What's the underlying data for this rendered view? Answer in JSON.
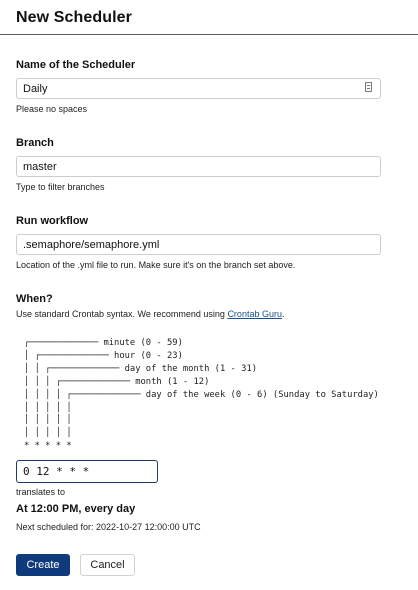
{
  "page": {
    "title": "New Scheduler"
  },
  "name_field": {
    "label": "Name of the Scheduler",
    "value": "Daily",
    "hint": "Please no spaces"
  },
  "branch_field": {
    "label": "Branch",
    "value": "master",
    "hint": "Type to filter branches"
  },
  "workflow_field": {
    "label": "Run workflow",
    "value": ".semaphore/semaphore.yml",
    "hint": "Location of the .yml file to run. Make sure it's on the branch set above."
  },
  "when": {
    "label": "When?",
    "hint_prefix": "Use standard Crontab syntax. We recommend using ",
    "hint_link": "Crontab Guru",
    "hint_suffix": ".",
    "diagram": "┌───────────── minute (0 - 59)\n│ ┌───────────── hour (0 - 23)\n│ │ ┌───────────── day of the month (1 - 31)\n│ │ │ ┌───────────── month (1 - 12)\n│ │ │ │ ┌───────────── day of the week (0 - 6) (Sunday to Saturday)\n│ │ │ │ │\n│ │ │ │ │\n│ │ │ │ │\n* * * * *",
    "cron_value": "0 12 * * *",
    "translates_label": "translates to",
    "result": "At 12:00 PM, every day",
    "next_scheduled": "Next scheduled for: 2022-10-27 12:00:00 UTC"
  },
  "actions": {
    "create": "Create",
    "cancel": "Cancel"
  }
}
